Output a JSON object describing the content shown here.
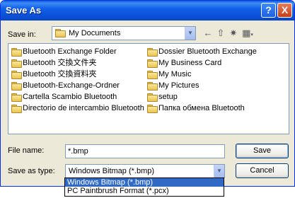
{
  "dialog": {
    "title": "Save As",
    "help_glyph": "?",
    "close_glyph": "X"
  },
  "save_in": {
    "label": "Save in:",
    "value": "My Documents",
    "icon": "my-documents-folder-icon"
  },
  "toolbar": {
    "back_glyph": "←",
    "up_glyph": "⇧",
    "new_folder_glyph": "✷",
    "views_glyph": "▦"
  },
  "files": [
    {
      "label": "Bluetooth Exchange Folder",
      "icon": "folder-icon"
    },
    {
      "label": "Bluetooth 交換文件夹",
      "icon": "folder-icon"
    },
    {
      "label": "Bluetooth 交換資料夾",
      "icon": "folder-icon"
    },
    {
      "label": "Bluetooth-Exchange-Ordner",
      "icon": "folder-icon"
    },
    {
      "label": "Cartella Scambio Bluetooth",
      "icon": "folder-icon"
    },
    {
      "label": "Directorio de intercambio Bluetooth",
      "icon": "folder-icon"
    },
    {
      "label": "Dossier Bluetooth Exchange",
      "icon": "folder-icon"
    },
    {
      "label": "My Business Card",
      "icon": "folder-icon"
    },
    {
      "label": "My Music",
      "icon": "music-folder-icon"
    },
    {
      "label": "My Pictures",
      "icon": "pictures-folder-icon"
    },
    {
      "label": "setup",
      "icon": "folder-icon"
    },
    {
      "label": "Папка обмена Bluetooth",
      "icon": "folder-icon"
    }
  ],
  "file_name": {
    "label": "File name:",
    "value": "*.bmp"
  },
  "save_as_type": {
    "label": "Save as type:",
    "value": "Windows Bitmap (*.bmp)",
    "options": [
      "Windows Bitmap (*.bmp)",
      "PC Paintbrush Format (*.pcx)"
    ]
  },
  "buttons": {
    "save": "Save",
    "cancel": "Cancel"
  }
}
